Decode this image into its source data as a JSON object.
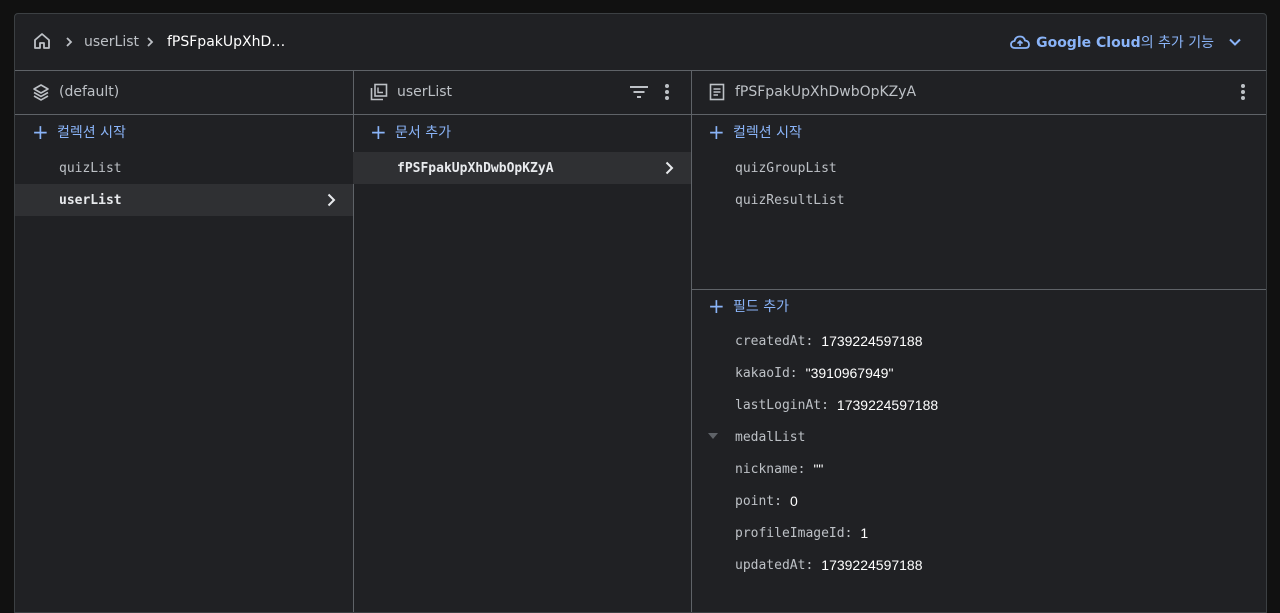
{
  "breadcrumb": {
    "home_icon": "home-icon",
    "separator_icon": "chevron-right-icon",
    "items": [
      "userList",
      "fPSFpakUpXhD…"
    ]
  },
  "cloud_link": {
    "icon": "cloud-icon",
    "brand": "Google Cloud",
    "suffix": "의 추가 기능",
    "expand_icon": "expand-more-icon"
  },
  "columns": {
    "root": {
      "icon": "database-layers-icon",
      "title": "(default)",
      "add_label": "컬렉션 시작",
      "items": [
        {
          "label": "quizList",
          "selected": false
        },
        {
          "label": "userList",
          "selected": true
        }
      ]
    },
    "collection": {
      "icon": "collection-icon",
      "title": "userList",
      "filter_icon": "filter-icon",
      "more_icon": "more-vert-icon",
      "add_label": "문서 추가",
      "items": [
        {
          "label": "fPSFpakUpXhDwbOpKZyA",
          "selected": true
        }
      ]
    },
    "document": {
      "icon": "document-icon",
      "title": "fPSFpakUpXhDwbOpKZyA",
      "more_icon": "more-vert-icon",
      "add_collection_label": "컬렉션 시작",
      "subcollections": [
        "quizGroupList",
        "quizResultList"
      ],
      "add_field_label": "필드 추가",
      "fields": [
        {
          "key": "createdAt",
          "value": "1739224597188"
        },
        {
          "key": "kakaoId",
          "value": "\"3910967949\""
        },
        {
          "key": "lastLoginAt",
          "value": "1739224597188"
        },
        {
          "key": "medalList",
          "value": "",
          "expandable": true
        },
        {
          "key": "nickname",
          "value": "\"\""
        },
        {
          "key": "point",
          "value": "0"
        },
        {
          "key": "profileImageId",
          "value": "1"
        },
        {
          "key": "updatedAt",
          "value": "1739224597188"
        }
      ]
    }
  },
  "colors": {
    "accent": "#8ab4f8",
    "background": "#202124",
    "divider": "#5f6368",
    "selected_row": "#2f3033"
  }
}
